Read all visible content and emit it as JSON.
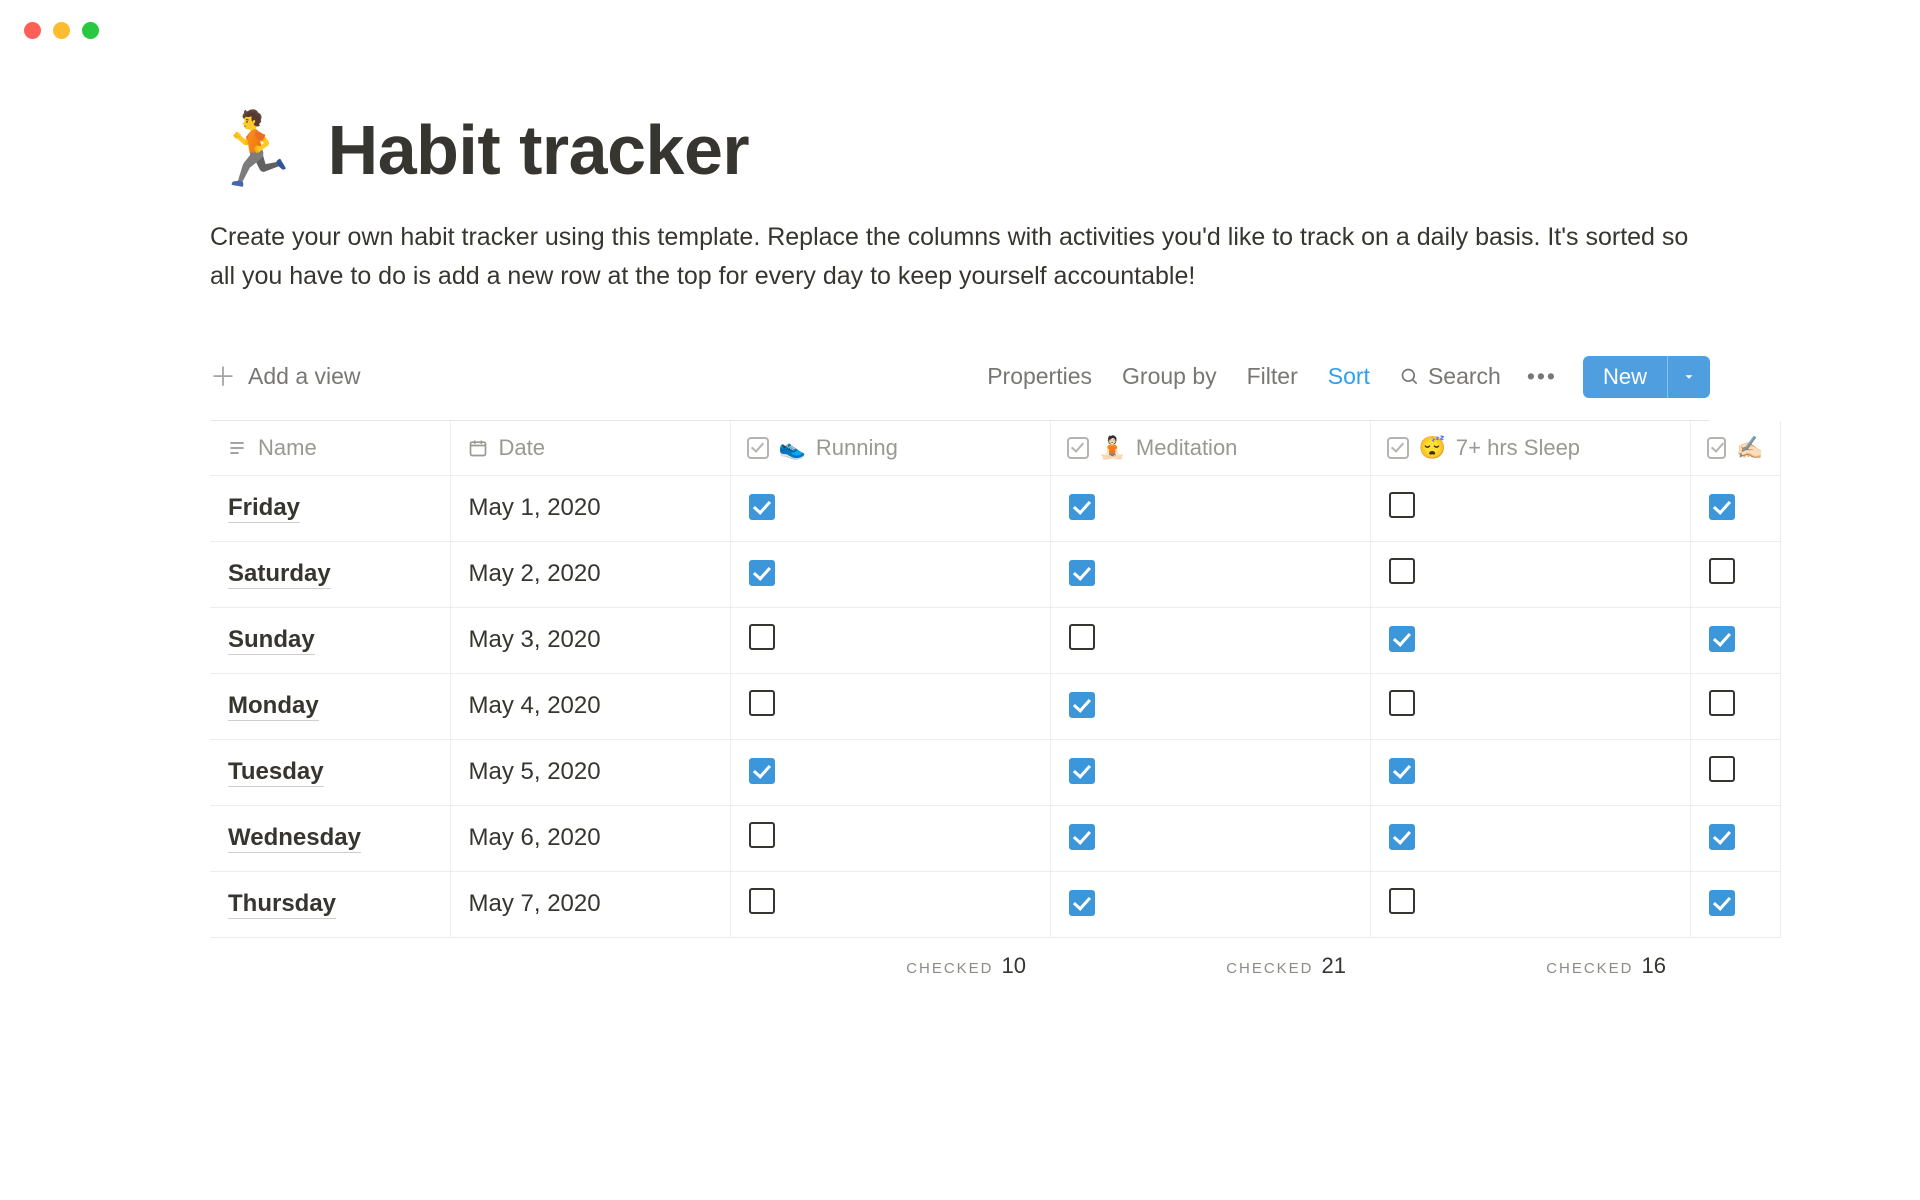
{
  "page": {
    "emoji": "🏃",
    "title": "Habit tracker",
    "description": "Create your own habit tracker using this template. Replace the columns with activities you'd like to track on a daily basis. It's sorted so all you have to do is add a new row at the top for every day to keep yourself accountable!"
  },
  "toolbar": {
    "add_view": "Add a view",
    "properties": "Properties",
    "group_by": "Group by",
    "filter": "Filter",
    "sort": "Sort",
    "search": "Search",
    "dots": "•••",
    "new_label": "New"
  },
  "columns": {
    "name": "Name",
    "date": "Date",
    "running_emoji": "👟",
    "running": "Running",
    "meditation_emoji": "🧘🏻",
    "meditation": "Meditation",
    "sleep_emoji": "😴",
    "sleep": "7+ hrs Sleep",
    "writing_emoji": "✍🏻"
  },
  "rows": [
    {
      "name": "Friday",
      "date": "May 1, 2020",
      "running": true,
      "meditation": true,
      "sleep": false,
      "writing": true
    },
    {
      "name": "Saturday",
      "date": "May 2, 2020",
      "running": true,
      "meditation": true,
      "sleep": false,
      "writing": false
    },
    {
      "name": "Sunday",
      "date": "May 3, 2020",
      "running": false,
      "meditation": false,
      "sleep": true,
      "writing": true
    },
    {
      "name": "Monday",
      "date": "May 4, 2020",
      "running": false,
      "meditation": true,
      "sleep": false,
      "writing": false
    },
    {
      "name": "Tuesday",
      "date": "May 5, 2020",
      "running": true,
      "meditation": true,
      "sleep": true,
      "writing": false
    },
    {
      "name": "Wednesday",
      "date": "May 6, 2020",
      "running": false,
      "meditation": true,
      "sleep": true,
      "writing": true
    },
    {
      "name": "Thursday",
      "date": "May 7, 2020",
      "running": false,
      "meditation": true,
      "sleep": false,
      "writing": true
    }
  ],
  "footer": {
    "label": "CHECKED",
    "running": "10",
    "meditation": "21",
    "sleep": "16"
  }
}
